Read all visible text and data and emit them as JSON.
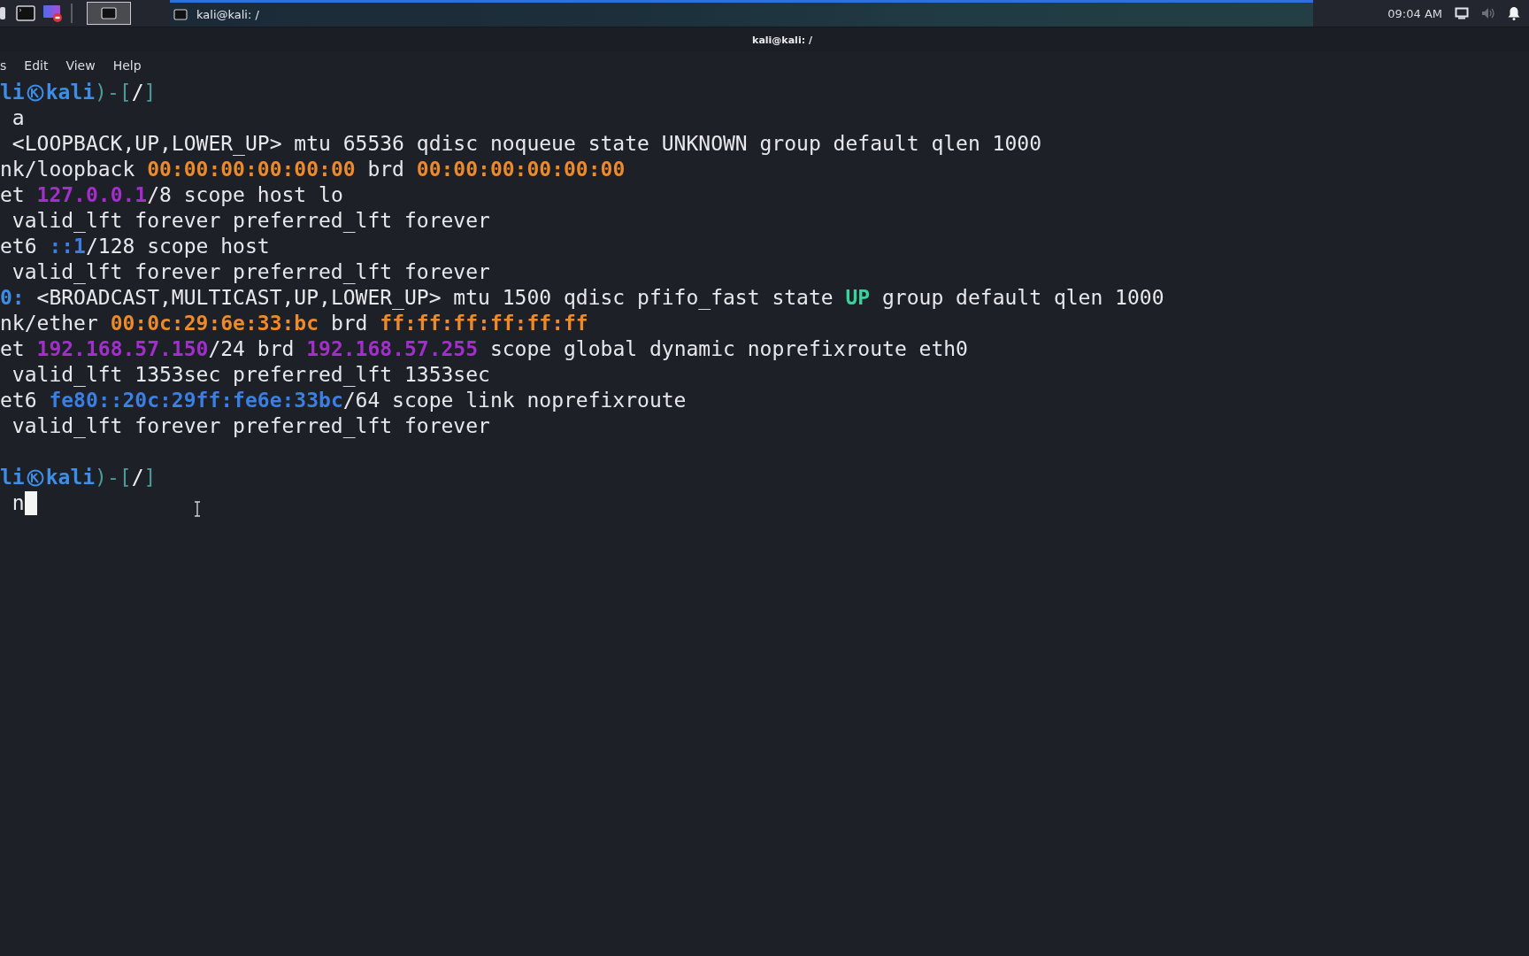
{
  "taskbar": {
    "task": {
      "title": "kali@kali: /",
      "selected": true
    },
    "clock": "09:04 AM"
  },
  "window": {
    "title": "kali@kali: /"
  },
  "menu": [
    "s",
    "Edit",
    "View",
    "Help"
  ],
  "terminal": {
    "cursor_visible": true,
    "lines": [
      {
        "kind": "text",
        "segments": [
          {
            "kind": "user",
            "text": "li"
          },
          {
            "kind": "logo"
          },
          {
            "kind": "user",
            "text": "kali"
          },
          {
            "kind": "bracket",
            "text": ")-["
          },
          {
            "kind": "path",
            "text": "/"
          },
          {
            "kind": "bracket",
            "text": "]"
          }
        ]
      },
      {
        "kind": "text",
        "segments": [
          {
            "kind": "plain",
            "text": " a"
          }
        ]
      },
      {
        "kind": "text",
        "segments": [
          {
            "kind": "plain",
            "text": " <LOOPBACK,UP,LOWER_UP> mtu 65536 qdisc noqueue state UNKNOWN group default qlen 1000"
          }
        ]
      },
      {
        "kind": "text",
        "segments": [
          {
            "kind": "plain",
            "text": "nk/loopback "
          },
          {
            "kind": "mac",
            "text": "00:00:00:00:00:00"
          },
          {
            "kind": "plain",
            "text": " brd "
          },
          {
            "kind": "mac",
            "text": "00:00:00:00:00:00"
          }
        ]
      },
      {
        "kind": "text",
        "segments": [
          {
            "kind": "plain",
            "text": "et "
          },
          {
            "kind": "ipv4",
            "text": "127.0.0.1"
          },
          {
            "kind": "plain",
            "text": "/8 scope host lo"
          }
        ]
      },
      {
        "kind": "text",
        "segments": [
          {
            "kind": "plain",
            "text": " valid_lft forever preferred_lft forever"
          }
        ]
      },
      {
        "kind": "text",
        "segments": [
          {
            "kind": "plain",
            "text": "et6 "
          },
          {
            "kind": "ipv6",
            "text": "::1"
          },
          {
            "kind": "plain",
            "text": "/128 scope host"
          }
        ]
      },
      {
        "kind": "text",
        "segments": [
          {
            "kind": "plain",
            "text": " valid_lft forever preferred_lft forever"
          }
        ]
      },
      {
        "kind": "text",
        "segments": [
          {
            "kind": "iface",
            "text": "0:"
          },
          {
            "kind": "plain",
            "text": " <BROADCAST,MULTICAST,UP,LOWER_UP> mtu 1500 qdisc pfifo_fast state "
          },
          {
            "kind": "state_up",
            "text": "UP"
          },
          {
            "kind": "plain",
            "text": " group default qlen 1000"
          }
        ]
      },
      {
        "kind": "text",
        "segments": [
          {
            "kind": "plain",
            "text": "nk/ether "
          },
          {
            "kind": "mac",
            "text": "00:0c:29:6e:33:bc"
          },
          {
            "kind": "plain",
            "text": " brd "
          },
          {
            "kind": "mac",
            "text": "ff:ff:ff:ff:ff:ff"
          }
        ]
      },
      {
        "kind": "text",
        "segments": [
          {
            "kind": "plain",
            "text": "et "
          },
          {
            "kind": "ipv4",
            "text": "192.168.57.150"
          },
          {
            "kind": "plain",
            "text": "/24 brd "
          },
          {
            "kind": "ipv4",
            "text": "192.168.57.255"
          },
          {
            "kind": "plain",
            "text": " scope global dynamic noprefixroute eth0"
          }
        ]
      },
      {
        "kind": "text",
        "segments": [
          {
            "kind": "plain",
            "text": " valid_lft 1353sec preferred_lft 1353sec"
          }
        ]
      },
      {
        "kind": "text",
        "segments": [
          {
            "kind": "plain",
            "text": "et6 "
          },
          {
            "kind": "ipv6",
            "text": "fe80::20c:29ff:fe6e:33bc"
          },
          {
            "kind": "plain",
            "text": "/64 scope link noprefixroute"
          }
        ]
      },
      {
        "kind": "text",
        "segments": [
          {
            "kind": "plain",
            "text": " valid_lft forever preferred_lft forever"
          }
        ]
      },
      {
        "kind": "blank"
      },
      {
        "kind": "text",
        "segments": [
          {
            "kind": "user",
            "text": "li"
          },
          {
            "kind": "logo"
          },
          {
            "kind": "user",
            "text": "kali"
          },
          {
            "kind": "bracket",
            "text": ")-["
          },
          {
            "kind": "path",
            "text": "/"
          },
          {
            "kind": "bracket",
            "text": "]"
          }
        ]
      },
      {
        "kind": "input",
        "segments": [
          {
            "kind": "plain",
            "text": " n"
          }
        ]
      }
    ]
  }
}
